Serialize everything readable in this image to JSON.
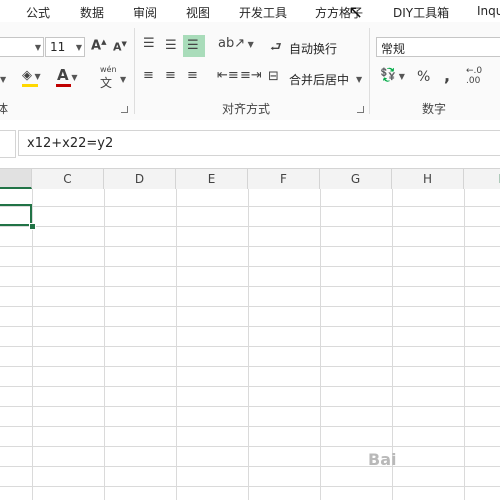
{
  "ribbon_tabs": [
    {
      "label": "公式"
    },
    {
      "label": "数据"
    },
    {
      "label": "审阅"
    },
    {
      "label": "视图"
    },
    {
      "label": "开发工具"
    },
    {
      "label": "方方格子"
    },
    {
      "label": "DIY工具箱"
    },
    {
      "label": "Inqu"
    }
  ],
  "font_group": {
    "label_fragment": "体",
    "font_size": "11",
    "font_color": "#c00000",
    "fill_color": "#ffd800",
    "phonetic_label": "wén"
  },
  "alignment_group": {
    "label": "对齐方式",
    "wrap_text_label": "自动换行",
    "merge_center_label": "合并后居中"
  },
  "number_group": {
    "label": "数字",
    "format_value": "常规",
    "percent_symbol": "%",
    "comma_symbol": ","
  },
  "formula_bar": {
    "value": "x12+x22=y2"
  },
  "columns": [
    "C",
    "D",
    "E",
    "F",
    "G",
    "H"
  ],
  "selection": {
    "color": "#217346"
  },
  "watermark": "Bai"
}
